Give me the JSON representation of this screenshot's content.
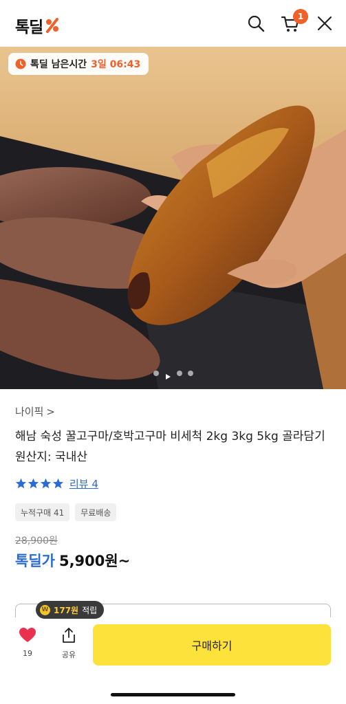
{
  "header": {
    "logo_text": "톡딜",
    "cart_count": "1",
    "brand_color": "#f0602a"
  },
  "timer": {
    "label": "톡딜 남은시간",
    "value": "3일 06:43"
  },
  "product": {
    "brand": "나이픽",
    "brand_chevron": ">",
    "title": "해남 숙성 꿀고구마/호박고구마 비세척 2kg 3kg 5kg 골라담기",
    "origin": "원산지: 국내산",
    "rating_stars": 4,
    "review_label": "리뷰 4",
    "tags": [
      "누적구매 41",
      "무료배송"
    ],
    "original_price": "28,900원",
    "price_label": "톡딜가",
    "price_value": "5,900원~"
  },
  "carousel": {
    "slide_count": 4,
    "current_slide": 2
  },
  "points": {
    "coin_symbol": "W",
    "amount": "177원",
    "suffix": "적립"
  },
  "bottom_bar": {
    "like_count": "19",
    "share_label": "공유",
    "buy_label": "구매하기",
    "buy_color": "#fde23b",
    "like_color": "#e8324f"
  }
}
